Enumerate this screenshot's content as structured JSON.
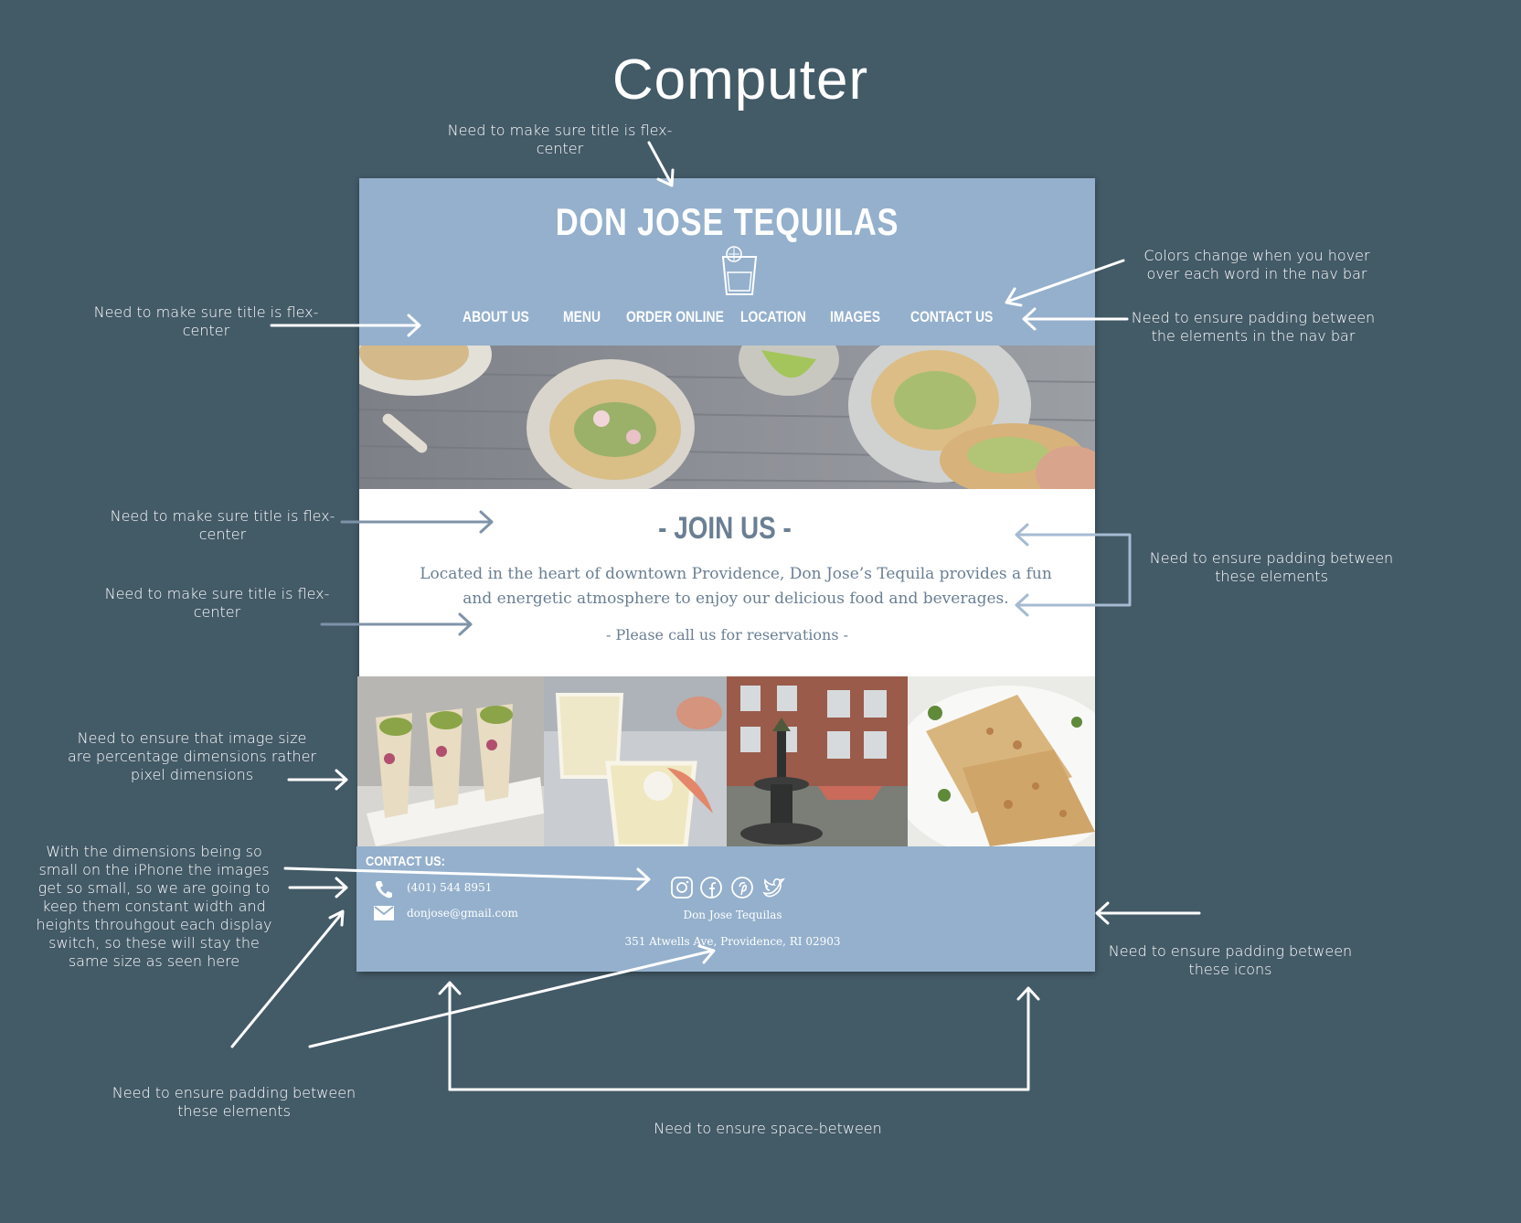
{
  "page": {
    "title": "Computer"
  },
  "site": {
    "brand": "DON JOSE TEQUILAS",
    "nav": [
      "ABOUT US",
      "MENU",
      "ORDER ONLINE",
      "LOCATION",
      "IMAGES",
      "CONTACT US"
    ],
    "join": {
      "title": "- JOIN US -",
      "text": "Located in the heart of downtown Providence, Don Jose’s Tequila  provides a fun and energetic atmosphere to enjoy our delicious food and beverages.",
      "call": "- Please call us for reservations -"
    },
    "footer": {
      "contact_heading": "CONTACT US:",
      "phone": "(401) 544 8951",
      "email": "donjose@gmail.com",
      "name": "Don Jose Tequilas",
      "address": "351 Atwells Ave, Providence, RI 02903",
      "socials": [
        "instagram-icon",
        "facebook-icon",
        "pinterest-icon",
        "twitter-icon"
      ]
    }
  },
  "annotations": {
    "title_center_top": "Need to make sure title is flex-center",
    "title_center_nav": "Need to make sure title is flex-center",
    "title_center_join": "Need to make sure title is flex-center",
    "title_center_text": "Need to make sure title is flex-center",
    "nav_hover": "Colors change when you hover over each word in the nav bar",
    "nav_padding": "Need to ensure padding between the elements in the nav bar",
    "join_padding": "Need to ensure padding between these elements",
    "image_percent": "Need to ensure that image size are percentage dimensions rather pixel dimensions",
    "iphone_images": "With the dimensions being so small on the iPhone the images get so small, so we are going to keep them constant width and heights throuhgout each display switch, so these will stay the same size as seen here",
    "icon_padding": "Need to ensure padding between these icons",
    "footer_padding": "Need to ensure padding between these elements",
    "space_between": "Need to ensure space-between"
  },
  "colors": {
    "background": "#435a67",
    "header": "#94b0cc",
    "accent_text": "#6a7f93"
  }
}
